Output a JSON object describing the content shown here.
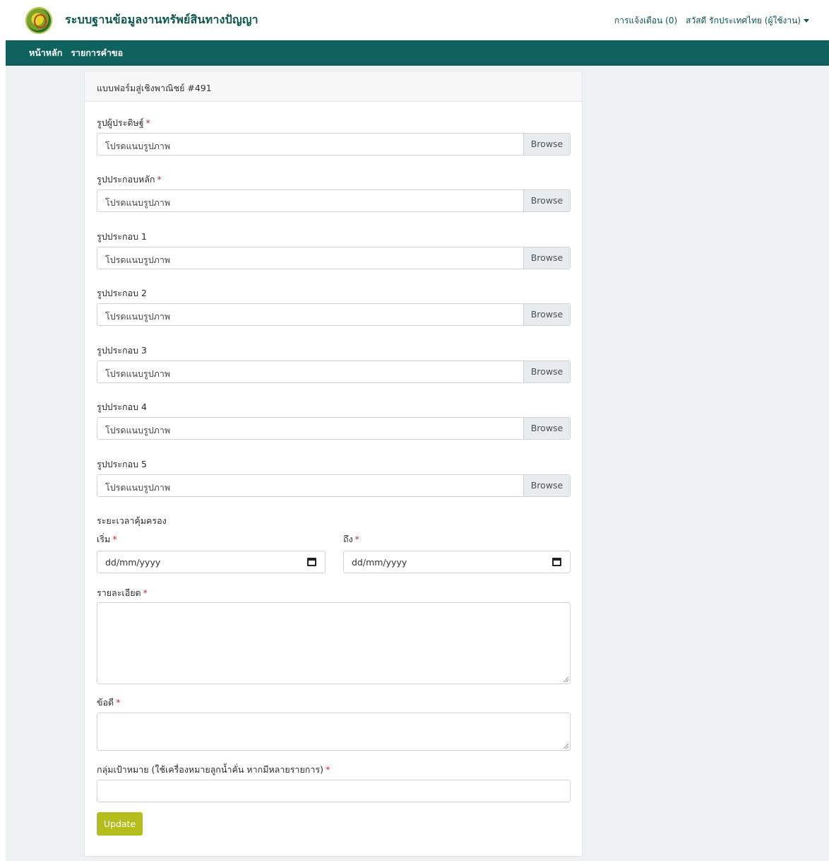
{
  "header": {
    "brand_title": "ระบบฐานข้อมูลงานทรัพย์สินทางปัญญา",
    "notifications": "การแจ้งเตือน (0)",
    "user_greeting": "สวัสดี รักประเทศไทย (ผู้ใช้งาน)"
  },
  "nav": {
    "home": "หน้าหลัก",
    "requests": "รายการคำขอ"
  },
  "form": {
    "title": "แบบฟอร์มสู่เชิงพาณิชย์ #491",
    "file_placeholder": "โปรดแนบรูปภาพ",
    "browse_label": "Browse",
    "file_fields": [
      {
        "label": "รูปผู้ประดิษฐ์",
        "required": "*"
      },
      {
        "label": "รูปประกอบหลัก",
        "required": "*"
      },
      {
        "label": "รูปประกอบ 1"
      },
      {
        "label": "รูปประกอบ 2"
      },
      {
        "label": "รูปประกอบ 3"
      },
      {
        "label": "รูปประกอบ 4"
      },
      {
        "label": "รูปประกอบ 5"
      }
    ],
    "protection_period_label": "ระยะเวลาคุ้มครอง",
    "start_label": "เริ่ม",
    "end_label": "ถึง",
    "required_mark": "*",
    "start_value": "dd/mm/yyyy",
    "end_value": "dd/mm/yyyy",
    "details_label": "รายละเอียด",
    "advantages_label": "ข้อดี",
    "target_group_label": "กลุ่มเป้าหมาย (ใช้เครื่องหมายลูกน้ำคั่น หากมีหลายรายการ)",
    "update_button": "Update"
  },
  "colors": {
    "nav_bg": "#0f625e",
    "brand_text": "#0f5550",
    "update_button": "#b4bd1c",
    "required": "#d9252b"
  }
}
